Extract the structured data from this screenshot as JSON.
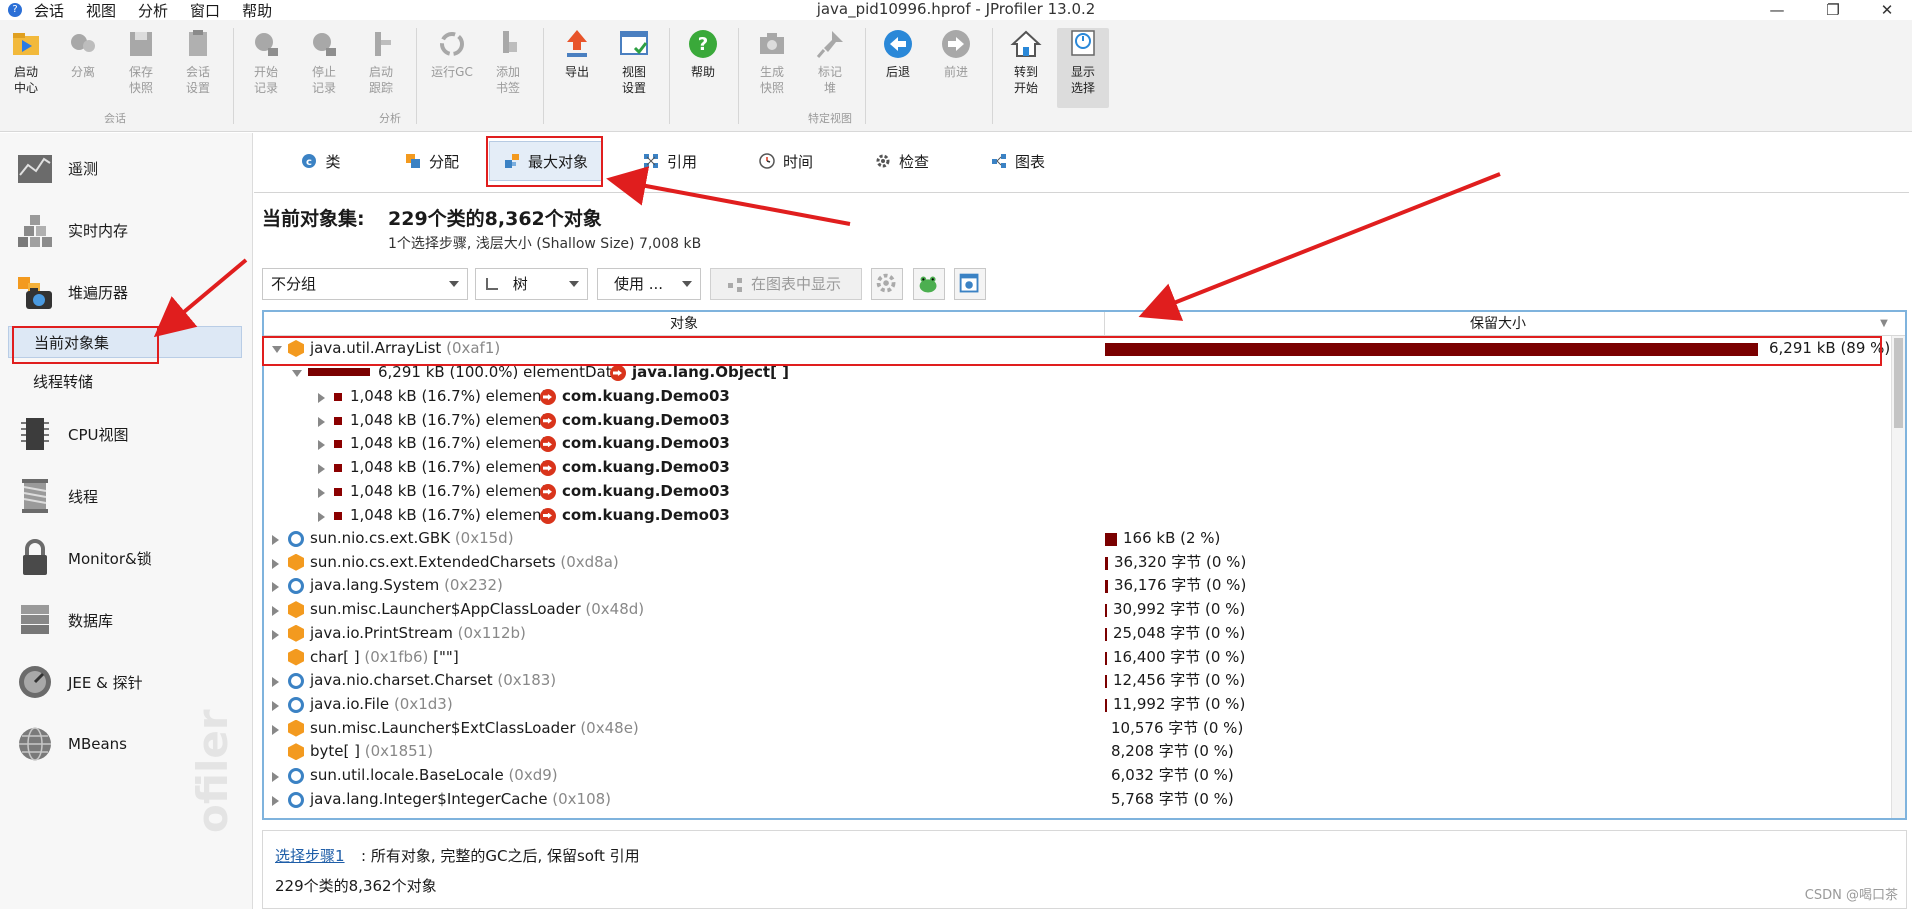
{
  "window": {
    "title": "java_pid10996.hprof - JProfiler 13.0.2",
    "menu": [
      "会话",
      "视图",
      "分析",
      "窗口",
      "帮助"
    ]
  },
  "toolbar": {
    "buttons": [
      {
        "label": "启动\n中心",
        "icon": "launch-center-icon"
      },
      {
        "label": "分离",
        "icon": "detach-icon"
      },
      {
        "label": "保存\n快照",
        "icon": "save-snapshot-icon"
      },
      {
        "label": "会话\n设置",
        "icon": "session-settings-icon"
      },
      {
        "label": "开始\n记录",
        "icon": "start-recording-icon"
      },
      {
        "label": "停止\n记录",
        "icon": "stop-recording-icon"
      },
      {
        "label": "启动\n跟踪",
        "icon": "start-tracking-icon"
      },
      {
        "label": "运行GC",
        "icon": "run-gc-icon"
      },
      {
        "label": "添加\n书签",
        "icon": "add-bookmark-icon"
      },
      {
        "label": "导出",
        "icon": "export-icon"
      },
      {
        "label": "视图\n设置",
        "icon": "view-settings-icon"
      },
      {
        "label": "帮助",
        "icon": "help-icon"
      },
      {
        "label": "生成\n快照",
        "icon": "snapshot-icon"
      },
      {
        "label": "标记\n堆",
        "icon": "mark-heap-icon"
      },
      {
        "label": "后退",
        "icon": "back-icon"
      },
      {
        "label": "前进",
        "icon": "forward-icon"
      },
      {
        "label": "转到\n开始",
        "icon": "home-icon"
      },
      {
        "label": "显示\n选择",
        "icon": "show-selection-icon"
      }
    ],
    "groups": [
      "会话",
      "分析",
      "特定视图"
    ]
  },
  "sidebar": {
    "items": [
      {
        "label": "遥测",
        "icon": "telemetry-icon"
      },
      {
        "label": "实时内存",
        "icon": "live-memory-icon"
      },
      {
        "label": "堆遍历器",
        "icon": "heap-walker-icon"
      },
      {
        "label": "CPU视图",
        "icon": "cpu-icon"
      },
      {
        "label": "线程",
        "icon": "threads-icon"
      },
      {
        "label": "Monitor&锁",
        "icon": "monitor-lock-icon"
      },
      {
        "label": "数据库",
        "icon": "database-icon"
      },
      {
        "label": "JEE & 探针",
        "icon": "jee-probe-icon"
      },
      {
        "label": "MBeans",
        "icon": "mbeans-icon"
      }
    ],
    "subitems": [
      "当前对象集",
      "线程转储"
    ],
    "watermark": "ofiler"
  },
  "tabs": [
    {
      "label": "类",
      "icon": "class-icon"
    },
    {
      "label": "分配",
      "icon": "allocation-icon"
    },
    {
      "label": "最大对象",
      "icon": "biggest-objects-icon"
    },
    {
      "label": "引用",
      "icon": "references-icon"
    },
    {
      "label": "时间",
      "icon": "time-icon"
    },
    {
      "label": "检查",
      "icon": "inspect-icon"
    },
    {
      "label": "图表",
      "icon": "graph-icon"
    }
  ],
  "header": {
    "label": "当前对象集:",
    "value": "229个类的8,362个对象",
    "sub": "1个选择步骤, 浅层大小  (Shallow Size)  7,008 kB"
  },
  "filters": {
    "grouping": "不分组",
    "view_mode": "树",
    "use": "使用 ...",
    "show_in_graph": "在图表中显示"
  },
  "table": {
    "col_object": "对象",
    "col_retained": "保留大小",
    "root": {
      "name": "java.util.ArrayList",
      "hex": "(0xaf1)",
      "size": "6,291 kB (89 %)",
      "fraction": 0.89
    },
    "element_data": {
      "prefix": "6,291 kB (100.0%) elementData",
      "target": "java.lang.Object[ ]"
    },
    "children": [
      {
        "prefix": "1,048 kB (16.7%) element",
        "target": "com.kuang.Demo03"
      },
      {
        "prefix": "1,048 kB (16.7%) element",
        "target": "com.kuang.Demo03"
      },
      {
        "prefix": "1,048 kB (16.7%) element",
        "target": "com.kuang.Demo03"
      },
      {
        "prefix": "1,048 kB (16.7%) element",
        "target": "com.kuang.Demo03"
      },
      {
        "prefix": "1,048 kB (16.7%) element",
        "target": "com.kuang.Demo03"
      },
      {
        "prefix": "1,048 kB (16.7%) element",
        "target": "com.kuang.Demo03"
      }
    ],
    "rows": [
      {
        "name": "sun.nio.cs.ext.GBK",
        "hex": "(0x15d)",
        "size": "166 kB (2 %)",
        "kind": "class",
        "expandable": true,
        "fraction": 0.0236
      },
      {
        "name": "sun.nio.cs.ext.ExtendedCharsets",
        "hex": "(0xd8a)",
        "size": "36,320 字节 (0 %)",
        "kind": "object",
        "expandable": true,
        "fraction": 0.0052
      },
      {
        "name": "java.lang.System",
        "hex": "(0x232)",
        "size": "36,176 字节 (0 %)",
        "kind": "class",
        "expandable": true,
        "fraction": 0.0052
      },
      {
        "name": "sun.misc.Launcher$AppClassLoader",
        "hex": "(0x48d)",
        "size": "30,992 字节 (0 %)",
        "kind": "object",
        "expandable": true,
        "fraction": 0.0044
      },
      {
        "name": "java.io.PrintStream",
        "hex": "(0x112b)",
        "size": "25,048 字节 (0 %)",
        "kind": "object",
        "expandable": true,
        "fraction": 0.0036
      },
      {
        "name": "char[ ]",
        "hex": "(0x1fb6)",
        "extra": "[\"\"]",
        "size": "16,400 字节 (0 %)",
        "kind": "object",
        "expandable": false,
        "fraction": 0.0023
      },
      {
        "name": "java.nio.charset.Charset",
        "hex": "(0x183)",
        "size": "12,456 字节 (0 %)",
        "kind": "class",
        "expandable": true,
        "fraction": 0.0018
      },
      {
        "name": "java.io.File",
        "hex": "(0x1d3)",
        "size": "11,992 字节 (0 %)",
        "kind": "class",
        "expandable": true,
        "fraction": 0.0017
      },
      {
        "name": "sun.misc.Launcher$ExtClassLoader",
        "hex": "(0x48e)",
        "size": "10,576 字节 (0 %)",
        "kind": "object",
        "expandable": true,
        "fraction": 0
      },
      {
        "name": "byte[ ]",
        "hex": "(0x1851)",
        "size": "8,208 字节 (0 %)",
        "kind": "object",
        "expandable": false,
        "fraction": 0
      },
      {
        "name": "sun.util.locale.BaseLocale",
        "hex": "(0xd9)",
        "size": "6,032 字节 (0 %)",
        "kind": "class",
        "expandable": true,
        "fraction": 0
      },
      {
        "name": "java.lang.Integer$IntegerCache",
        "hex": "(0x108)",
        "size": "5,768 字节 (0 %)",
        "kind": "class",
        "expandable": true,
        "fraction": 0
      }
    ]
  },
  "bottom": {
    "step_link": "选择步骤1",
    "step_text": ":  所有对象, 完整的GC之后, 保留soft 引用",
    "count": "229个类的8,362个对象"
  },
  "watermark": "CSDN @喝口茶",
  "colors": {
    "bar": "#7a0000",
    "annotation": "#e01e1e",
    "tab_active": "#e4edf7"
  }
}
